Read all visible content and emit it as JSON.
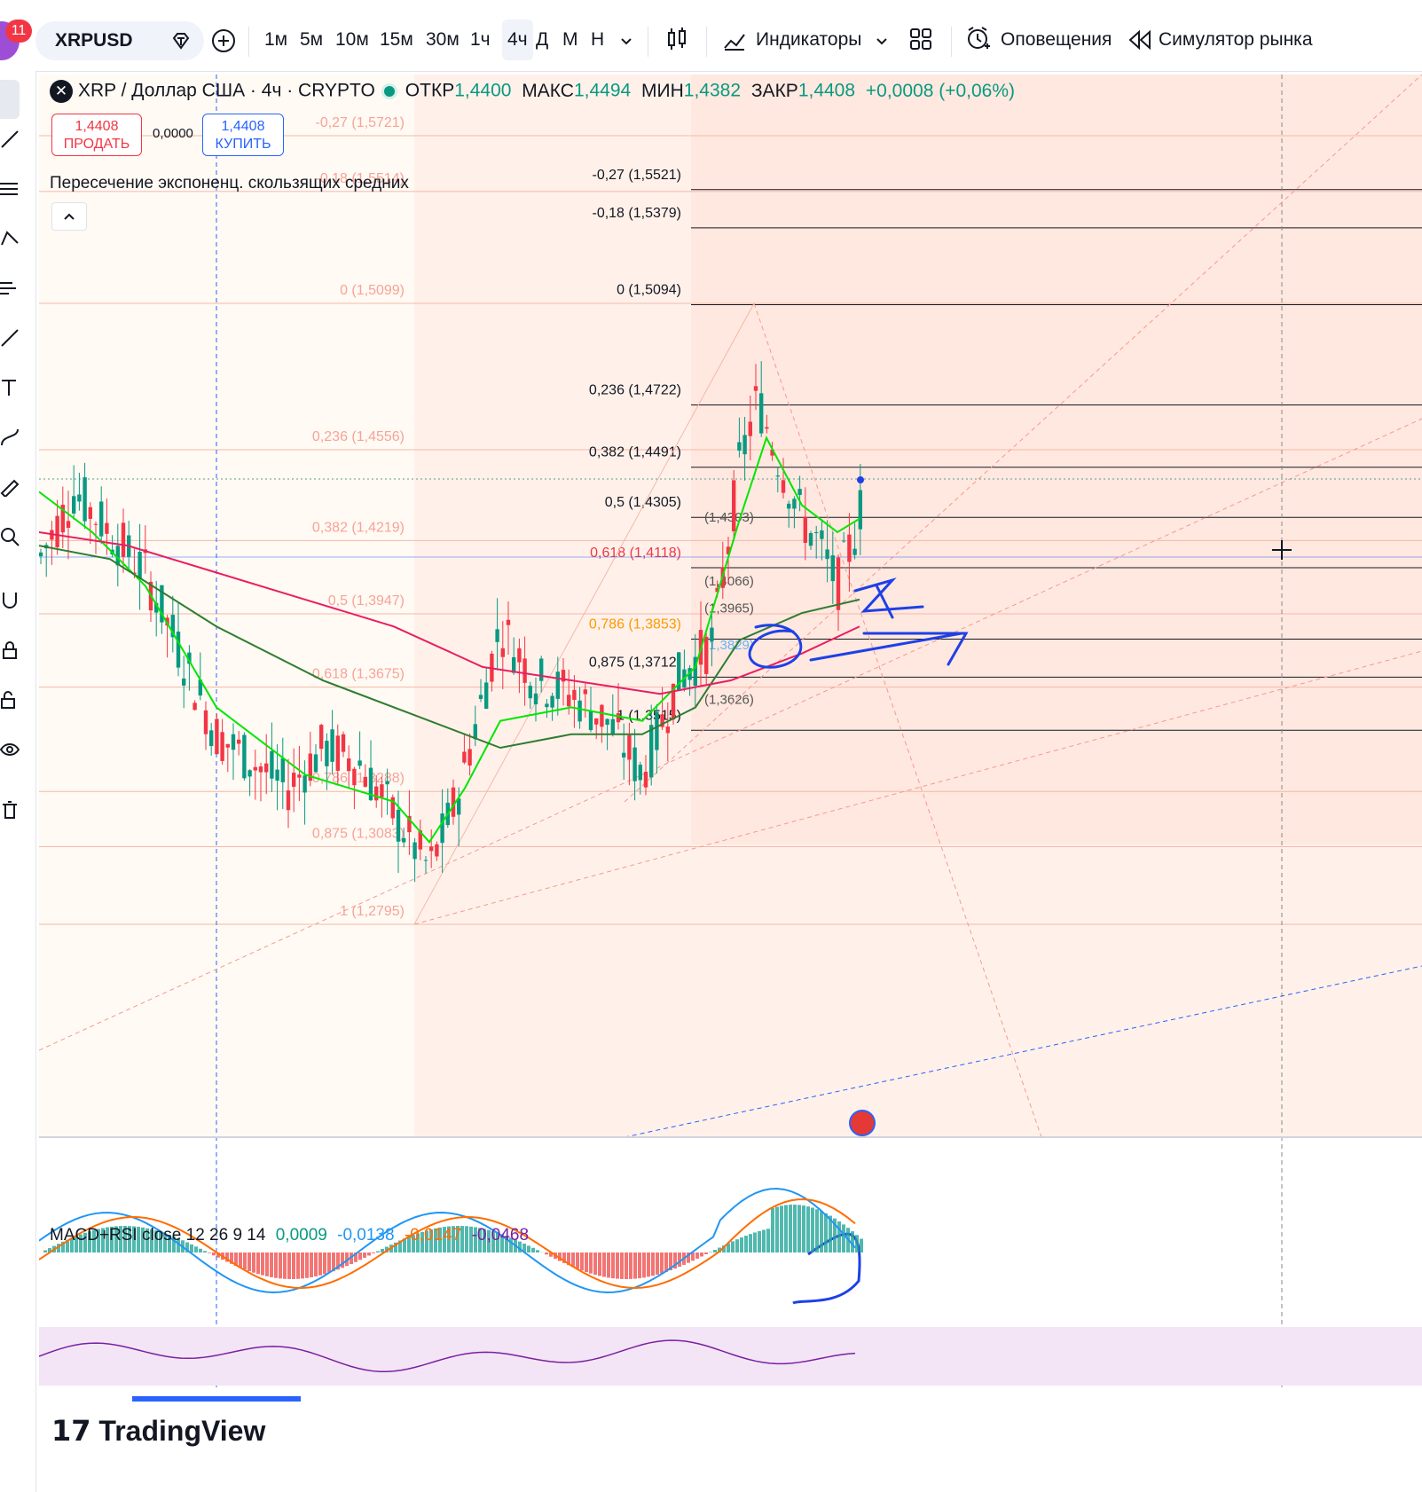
{
  "toolbar": {
    "notifications_count": "11",
    "symbol": "XRPUSD",
    "intervals": [
      "1м",
      "5м",
      "10м",
      "15м",
      "30м",
      "1ч",
      "4ч",
      "Д",
      "М",
      "Н"
    ],
    "active_interval": "4ч",
    "indicators_label": "Индикаторы",
    "alerts_label": "Оповещения",
    "replay_label": "Симулятор рынка"
  },
  "legend": {
    "pair": "XRP / Доллар США · 4ч · CRYPTO",
    "open_label": "ОТКР",
    "open": "1,4400",
    "high_label": "МАКС",
    "high": "1,4494",
    "low_label": "МИН",
    "low": "1,4382",
    "close_label": "ЗАКР",
    "close": "1,4408",
    "change": "+0,0008 (+0,06%)"
  },
  "trade": {
    "sell_price": "1,4408",
    "sell_label": "ПРОДАТЬ",
    "spread": "0,0000",
    "buy_price": "1,4408",
    "buy_label": "КУПИТЬ"
  },
  "indicator_name": "Пересечение экспоненц. скользящих средних",
  "fib_left": [
    {
      "label": "-0,27 (1,5721)",
      "price": 1.5721
    },
    {
      "label": "-0,18 (1,5514)",
      "price": 1.5514
    },
    {
      "label": "0 (1,5099)",
      "price": 1.5099
    },
    {
      "label": "0,236 (1,4556)",
      "price": 1.4556
    },
    {
      "label": "0,382 (1,4219)",
      "price": 1.4219
    },
    {
      "label": "0,5 (1,3947)",
      "price": 1.3947
    },
    {
      "label": "0,618 (1,3675)",
      "price": 1.3675
    },
    {
      "label": "0,786 (1,3288)",
      "price": 1.3288
    },
    {
      "label": "0,875 (1,3083)",
      "price": 1.3083
    },
    {
      "label": "1 (1,2795)",
      "price": 1.2795
    }
  ],
  "fib_right": [
    {
      "label": "-0,27 (1,5521)",
      "price": 1.5521
    },
    {
      "label": "-0,18 (1,5379)",
      "price": 1.5379
    },
    {
      "label": "0 (1,5094)",
      "price": 1.5094
    },
    {
      "label": "0,236 (1,4722)",
      "price": 1.4722
    },
    {
      "label": "0,382 (1,4491)",
      "price": 1.4491
    },
    {
      "label": "0,5 (1,4305)",
      "price": 1.4305
    },
    {
      "label": "0,618 (1,4118)",
      "price": 1.4118
    },
    {
      "label": "0,786 (1,3853)",
      "price": 1.3853
    },
    {
      "label": "0,875 (1,3712)",
      "price": 1.3712
    },
    {
      "label": "1 (1,3515)",
      "price": 1.3515
    }
  ],
  "fib_mid_labels": [
    "(1,4303)",
    "(1,4066)",
    "(1,3965)",
    "(1,3829)",
    "(1,3626)"
  ],
  "macd_legend": {
    "name": "MACD+RSI close 12 26 9 14",
    "v1": "0,0009",
    "v2": "-0,0138",
    "v3": "-0,0147",
    "v4": "-0,0468"
  },
  "watermark": "TradingView",
  "colors": {
    "up": "#089981",
    "down": "#f23645",
    "ema_fast": "#00e600",
    "ema_slow": "#2e7d32",
    "ema_long": "#e91e63",
    "drawing": "#1e40e6",
    "fib_right": "#131722",
    "fib_left": "#f7a399"
  },
  "chart_data": {
    "type": "candlestick",
    "title": "XRP / Доллар США · 4ч · CRYPTO",
    "ohlc_last": {
      "open": 1.44,
      "high": 1.4494,
      "low": 1.4382,
      "close": 1.4408
    }
  }
}
